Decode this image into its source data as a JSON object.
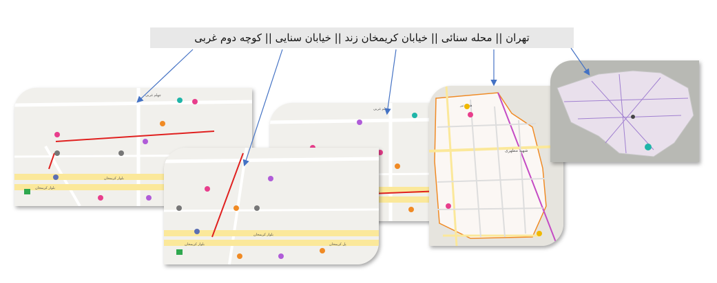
{
  "caption": "تهران || محله سنائی || خیابان کریمخان زند || خیابان سنایی || کوچه دوم غربی",
  "map_labels": {
    "karimkhan_blvd": "بلوار کریمخان",
    "karimkhan_bridge": "پل کریمخان",
    "shahid_motahari": "شهید مطهری",
    "haft_tir": "هفت تیر",
    "chehelom_gharbi": "چهلم غربی"
  },
  "colors": {
    "highlight_line": "#e0201f",
    "arrow": "#4472c4",
    "district_outline": "#f08a24",
    "map_bg": "#f1f0ec",
    "main_road": "#fbe89a"
  }
}
